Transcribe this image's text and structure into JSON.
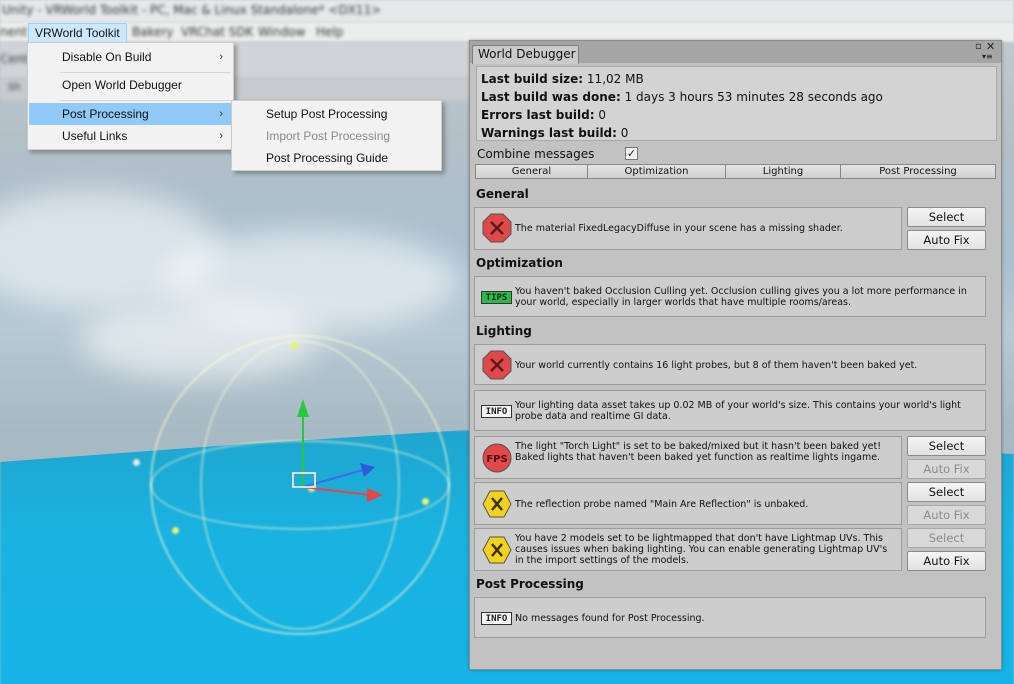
{
  "window_title": "Unity - VRWorld Toolkit - PC, Mac & Linux Standalone* <DX11>",
  "menubar": {
    "active": "VRWorld Toolkit",
    "partial_left": "nent",
    "items": [
      "Bakery",
      "VRChat SDK",
      "Window",
      "Help"
    ]
  },
  "toolbar": {
    "center_label": "Cente",
    "tab_label": "Sh"
  },
  "dropdown_main": {
    "items": [
      {
        "label": "Disable On Build",
        "arrow": "›"
      },
      {
        "label": "Open World Debugger"
      },
      {
        "label": "Post Processing",
        "arrow": "›"
      },
      {
        "label": "Useful Links",
        "arrow": "›"
      }
    ]
  },
  "dropdown_sub": {
    "items": [
      {
        "label": "Setup Post Processing"
      },
      {
        "label": "Import Post Processing"
      },
      {
        "label": "Post Processing Guide"
      }
    ]
  },
  "debugger": {
    "tab_title": "World Debugger",
    "window_controls": {
      "maximize": "▫",
      "close": "✕",
      "menu": "▾≡"
    },
    "build_info": {
      "size_label": "Last build size:",
      "size_value": " 11,02 MB",
      "done_label": "Last build was done:",
      "done_value": " 1 days 3 hours 53 minutes 28 seconds ago",
      "errors_label": "Errors last build:",
      "errors_value": " 0",
      "warnings_label": "Warnings last build:",
      "warnings_value": " 0"
    },
    "combine_label": "Combine messages",
    "combine_checked": "✓",
    "filter_tabs": [
      "General",
      "Optimization",
      "Lighting",
      "Post Processing"
    ],
    "sections": {
      "general": "General",
      "optimization": "Optimization",
      "lighting": "Lighting",
      "post_processing": "Post Processing"
    },
    "messages": {
      "general_1": "The material FixedLegacyDiffuse in your scene has a missing shader.",
      "opt_1": "You haven't baked Occlusion Culling yet. Occlusion culling gives you a lot more performance in your world, especially in larger worlds that have multiple rooms/areas.",
      "light_1": "Your world currently contains 16 light probes, but 8 of them haven't been baked yet.",
      "light_2": "Your lighting data asset takes up 0.02 MB of your world's size. This contains your world's light probe data and realtime GI data.",
      "light_3": "The light \"Torch Light\" is set to be baked/mixed but it hasn't been baked yet! Baked lights that haven't been baked yet function as realtime lights ingame.",
      "light_4": "The reflection probe named \"Main Are Reflection\" is unbaked.",
      "light_5": "You have 2 models set to be lightmapped that don't have Lightmap UVs. This causes issues when baking lighting. You can enable generating Lightmap UV's in the import settings of the models.",
      "pp_1": "No messages found for Post Processing."
    },
    "badges": {
      "tips": "TIPS",
      "info": "INFO",
      "fps": "FPS"
    },
    "buttons": {
      "select": "Select",
      "autofix": "Auto Fix"
    },
    "colors": {
      "error": "#e0484a",
      "warning": "#f2d21c",
      "tips": "#2db84a",
      "panel": "#c2c2c2"
    }
  }
}
